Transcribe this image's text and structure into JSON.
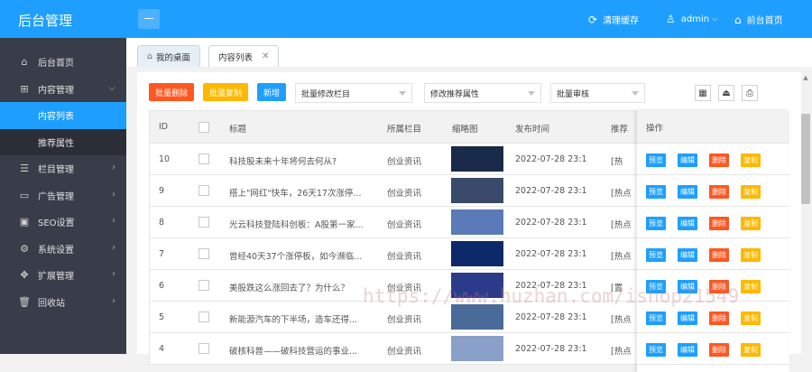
{
  "header": {
    "brand": "后台管理",
    "clear_cache": "清理缓存",
    "user": "admin",
    "front_home": "前台首页"
  },
  "sidebar": {
    "items": [
      {
        "label": "后台首页",
        "icon": "home-icon"
      },
      {
        "label": "内容管理",
        "icon": "grid-icon",
        "expanded": true,
        "children": [
          {
            "label": "内容列表",
            "active": true
          },
          {
            "label": "推荐属性",
            "active": false
          }
        ]
      },
      {
        "label": "栏目管理",
        "icon": "list-icon"
      },
      {
        "label": "广告管理",
        "icon": "monitor-icon"
      },
      {
        "label": "SEO设置",
        "icon": "seo-icon"
      },
      {
        "label": "系统设置",
        "icon": "gear-icon"
      },
      {
        "label": "扩展管理",
        "icon": "puzzle-icon"
      },
      {
        "label": "回收站",
        "icon": "trash-icon"
      }
    ]
  },
  "tabs": [
    {
      "label": "我的桌面",
      "icon": "home-icon",
      "active": false
    },
    {
      "label": "内容列表",
      "active": true,
      "closable": true
    }
  ],
  "toolbar": {
    "batch_delete": "批量删除",
    "batch_copy": "批量复制",
    "add": "新增",
    "select_column": "批量修改栏目",
    "select_attr": "修改推荐属性",
    "select_review": "批量审核"
  },
  "table": {
    "headers": {
      "id": "ID",
      "title": "标题",
      "column": "所属栏目",
      "thumb": "缩略图",
      "time": "发布时间",
      "recommend": "推荐",
      "actions": "操作"
    },
    "action_labels": {
      "view": "预览",
      "edit": "编辑",
      "delete": "删除",
      "copy": "复制"
    },
    "rows": [
      {
        "id": "10",
        "title": "科技股未来十年将何去何从?",
        "column": "创业资讯",
        "time": "2022-07-28 23:1",
        "rec": "[热",
        "thumb_color": "#1a2a4a"
      },
      {
        "id": "9",
        "title": "搭上\"网红\"快车，26天17次涨停...",
        "column": "创业资讯",
        "time": "2022-07-28 23:1",
        "rec": "[热点",
        "thumb_color": "#3a4a6a"
      },
      {
        "id": "8",
        "title": "光云科技登陆科创板：A股第一家...",
        "column": "创业资讯",
        "time": "2022-07-28 23:1",
        "rec": "[热点",
        "thumb_color": "#5a7ab8"
      },
      {
        "id": "7",
        "title": "曾经40天37个涨停板，如今濒临...",
        "column": "创业资讯",
        "time": "2022-07-28 23:1",
        "rec": "[热点",
        "thumb_color": "#0c2a6a"
      },
      {
        "id": "6",
        "title": "美股跌这么涨回去了？为什么？",
        "column": "创业资讯",
        "time": "2022-07-28 23:1",
        "rec": "[置",
        "thumb_color": "#2c3a8a"
      },
      {
        "id": "5",
        "title": "新能源汽车的下半场，造车还得...",
        "column": "创业资讯",
        "time": "2022-07-28 23:1",
        "rec": "[热点",
        "thumb_color": "#4a6a9a"
      },
      {
        "id": "4",
        "title": "破核科普——破科技营运的事业...",
        "column": "创业资讯",
        "time": "2022-07-28 23:1",
        "rec": "[热点",
        "thumb_color": "#8aa0c8"
      }
    ]
  },
  "watermark": "https://www.huzhan.com/ishop21549"
}
